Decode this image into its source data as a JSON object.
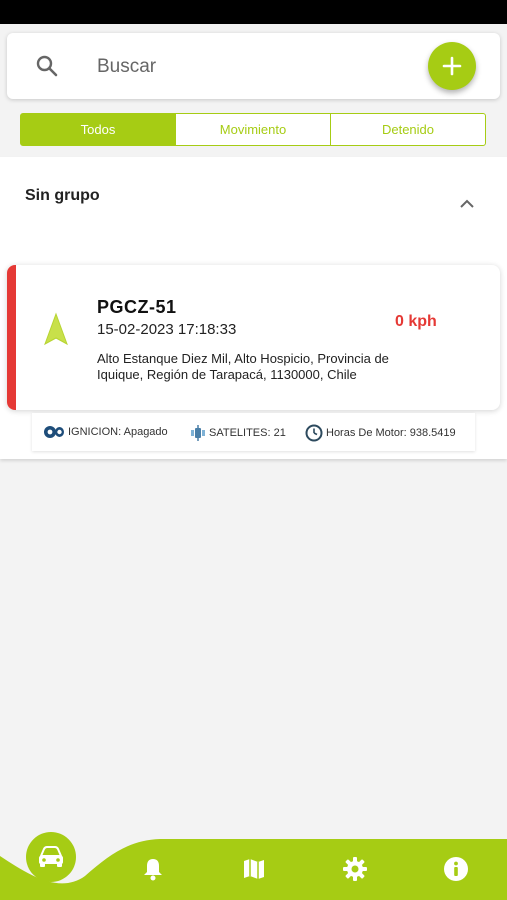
{
  "search": {
    "placeholder": "Buscar"
  },
  "tabs": [
    {
      "label": "Todos",
      "active": true
    },
    {
      "label": "Movimiento",
      "active": false
    },
    {
      "label": "Detenido",
      "active": false
    }
  ],
  "group": {
    "title": "Sin grupo"
  },
  "vehicle": {
    "plate": "PGCZ-51",
    "timestamp": "15-02-2023 17:18:33",
    "address": "Alto Estanque Diez Mil, Alto Hospicio, Provincia de Iquique, Región de Tarapacá, 1130000, Chile",
    "speed": "0 kph",
    "status_color": "#e53935",
    "ignition": "IGNICION: Apagado",
    "satellites": "SATELITES: 21",
    "motor_hours": "Horas De Motor: 938.5419"
  },
  "colors": {
    "accent": "#a6cc14",
    "alert": "#e53935"
  },
  "nav": [
    "car-icon",
    "bell-icon",
    "map-icon",
    "gear-icon",
    "info-icon"
  ]
}
